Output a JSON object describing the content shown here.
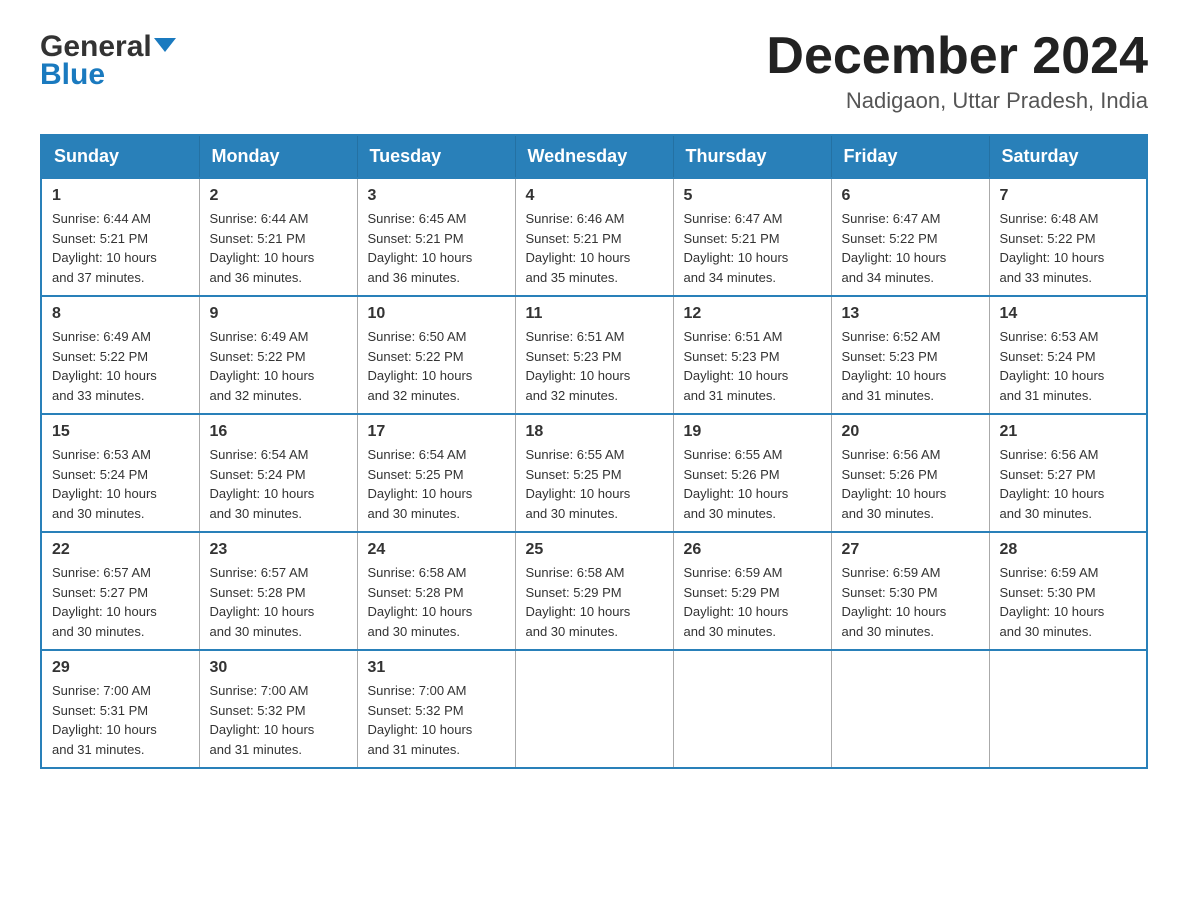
{
  "header": {
    "logo": {
      "general": "General",
      "blue": "Blue",
      "arrow_color": "#1a7abf"
    },
    "month_title": "December 2024",
    "location": "Nadigaon, Uttar Pradesh, India"
  },
  "calendar": {
    "days_of_week": [
      "Sunday",
      "Monday",
      "Tuesday",
      "Wednesday",
      "Thursday",
      "Friday",
      "Saturday"
    ],
    "weeks": [
      [
        {
          "day": "1",
          "sunrise": "6:44 AM",
          "sunset": "5:21 PM",
          "daylight": "10 hours and 37 minutes."
        },
        {
          "day": "2",
          "sunrise": "6:44 AM",
          "sunset": "5:21 PM",
          "daylight": "10 hours and 36 minutes."
        },
        {
          "day": "3",
          "sunrise": "6:45 AM",
          "sunset": "5:21 PM",
          "daylight": "10 hours and 36 minutes."
        },
        {
          "day": "4",
          "sunrise": "6:46 AM",
          "sunset": "5:21 PM",
          "daylight": "10 hours and 35 minutes."
        },
        {
          "day": "5",
          "sunrise": "6:47 AM",
          "sunset": "5:21 PM",
          "daylight": "10 hours and 34 minutes."
        },
        {
          "day": "6",
          "sunrise": "6:47 AM",
          "sunset": "5:22 PM",
          "daylight": "10 hours and 34 minutes."
        },
        {
          "day": "7",
          "sunrise": "6:48 AM",
          "sunset": "5:22 PM",
          "daylight": "10 hours and 33 minutes."
        }
      ],
      [
        {
          "day": "8",
          "sunrise": "6:49 AM",
          "sunset": "5:22 PM",
          "daylight": "10 hours and 33 minutes."
        },
        {
          "day": "9",
          "sunrise": "6:49 AM",
          "sunset": "5:22 PM",
          "daylight": "10 hours and 32 minutes."
        },
        {
          "day": "10",
          "sunrise": "6:50 AM",
          "sunset": "5:22 PM",
          "daylight": "10 hours and 32 minutes."
        },
        {
          "day": "11",
          "sunrise": "6:51 AM",
          "sunset": "5:23 PM",
          "daylight": "10 hours and 32 minutes."
        },
        {
          "day": "12",
          "sunrise": "6:51 AM",
          "sunset": "5:23 PM",
          "daylight": "10 hours and 31 minutes."
        },
        {
          "day": "13",
          "sunrise": "6:52 AM",
          "sunset": "5:23 PM",
          "daylight": "10 hours and 31 minutes."
        },
        {
          "day": "14",
          "sunrise": "6:53 AM",
          "sunset": "5:24 PM",
          "daylight": "10 hours and 31 minutes."
        }
      ],
      [
        {
          "day": "15",
          "sunrise": "6:53 AM",
          "sunset": "5:24 PM",
          "daylight": "10 hours and 30 minutes."
        },
        {
          "day": "16",
          "sunrise": "6:54 AM",
          "sunset": "5:24 PM",
          "daylight": "10 hours and 30 minutes."
        },
        {
          "day": "17",
          "sunrise": "6:54 AM",
          "sunset": "5:25 PM",
          "daylight": "10 hours and 30 minutes."
        },
        {
          "day": "18",
          "sunrise": "6:55 AM",
          "sunset": "5:25 PM",
          "daylight": "10 hours and 30 minutes."
        },
        {
          "day": "19",
          "sunrise": "6:55 AM",
          "sunset": "5:26 PM",
          "daylight": "10 hours and 30 minutes."
        },
        {
          "day": "20",
          "sunrise": "6:56 AM",
          "sunset": "5:26 PM",
          "daylight": "10 hours and 30 minutes."
        },
        {
          "day": "21",
          "sunrise": "6:56 AM",
          "sunset": "5:27 PM",
          "daylight": "10 hours and 30 minutes."
        }
      ],
      [
        {
          "day": "22",
          "sunrise": "6:57 AM",
          "sunset": "5:27 PM",
          "daylight": "10 hours and 30 minutes."
        },
        {
          "day": "23",
          "sunrise": "6:57 AM",
          "sunset": "5:28 PM",
          "daylight": "10 hours and 30 minutes."
        },
        {
          "day": "24",
          "sunrise": "6:58 AM",
          "sunset": "5:28 PM",
          "daylight": "10 hours and 30 minutes."
        },
        {
          "day": "25",
          "sunrise": "6:58 AM",
          "sunset": "5:29 PM",
          "daylight": "10 hours and 30 minutes."
        },
        {
          "day": "26",
          "sunrise": "6:59 AM",
          "sunset": "5:29 PM",
          "daylight": "10 hours and 30 minutes."
        },
        {
          "day": "27",
          "sunrise": "6:59 AM",
          "sunset": "5:30 PM",
          "daylight": "10 hours and 30 minutes."
        },
        {
          "day": "28",
          "sunrise": "6:59 AM",
          "sunset": "5:30 PM",
          "daylight": "10 hours and 30 minutes."
        }
      ],
      [
        {
          "day": "29",
          "sunrise": "7:00 AM",
          "sunset": "5:31 PM",
          "daylight": "10 hours and 31 minutes."
        },
        {
          "day": "30",
          "sunrise": "7:00 AM",
          "sunset": "5:32 PM",
          "daylight": "10 hours and 31 minutes."
        },
        {
          "day": "31",
          "sunrise": "7:00 AM",
          "sunset": "5:32 PM",
          "daylight": "10 hours and 31 minutes."
        },
        null,
        null,
        null,
        null
      ]
    ]
  },
  "labels": {
    "sunrise": "Sunrise: ",
    "sunset": "Sunset: ",
    "daylight": "Daylight: "
  }
}
